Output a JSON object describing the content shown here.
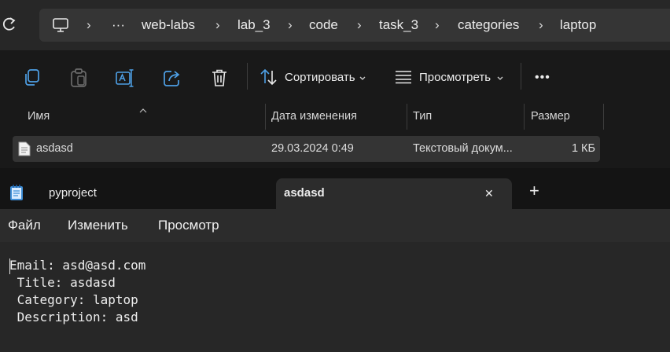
{
  "addressbar": {
    "refresh_icon": "refresh-icon",
    "computer_icon": "computer-icon",
    "overflow_label": "···",
    "separator": "›",
    "crumbs": [
      "web-labs",
      "lab_3",
      "code",
      "task_3",
      "categories",
      "laptop"
    ]
  },
  "toolbar": {
    "icons": [
      "copy-icon",
      "paste-icon",
      "rename-icon",
      "share-icon",
      "delete-icon"
    ],
    "sort_label": "Сортировать",
    "view_label": "Просмотреть",
    "more_label": "•••"
  },
  "filelist": {
    "columns": [
      "Имя",
      "Дата изменения",
      "Тип",
      "Размер"
    ],
    "rows": [
      {
        "name": "asdasd",
        "modified": "29.03.2024 0:49",
        "type": "Текстовый докум...",
        "size": "1 КБ"
      }
    ]
  },
  "notepad": {
    "tabs": [
      {
        "label": "pyproject"
      },
      {
        "label": "asdasd"
      }
    ],
    "close_label": "✕",
    "new_tab_label": "+",
    "menu": [
      "Файл",
      "Изменить",
      "Просмотр"
    ],
    "content_lines": [
      "Email: asd@asd.com",
      " Title: asdasd",
      " Category: laptop",
      " Description: asd"
    ]
  },
  "colors": {
    "accent": "#4ea0e6",
    "window_bg": "#202020",
    "toolbar_bg": "#191919"
  }
}
